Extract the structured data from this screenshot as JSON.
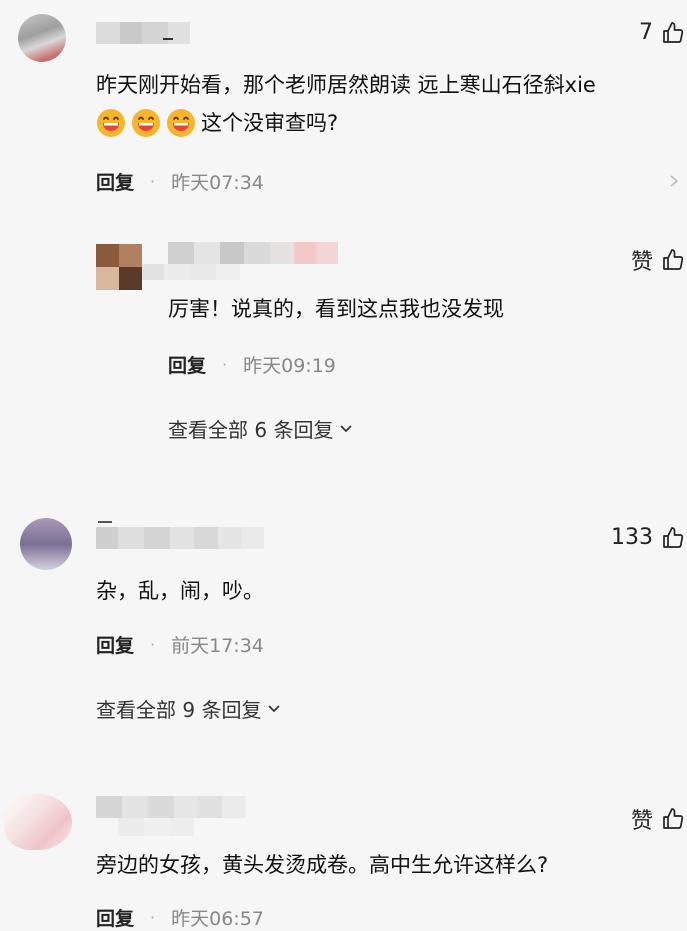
{
  "comments": [
    {
      "likes": "7",
      "text_line1": "昨天刚开始看，那个老师居然朗读 远上寒山石径斜xie",
      "text_line2": "这个没审查吗?",
      "reply_label": "回复",
      "time": "昨天07:34",
      "emoji_name": "grinning-face-emoji"
    },
    {
      "likes": "赞",
      "text": "厉害！说真的，看到这点我也没发现",
      "reply_label": "回复",
      "time": "昨天09:19",
      "view_more": "查看全部 6 条回复"
    },
    {
      "likes": "133",
      "text": "杂，乱，闹，吵。",
      "reply_label": "回复",
      "time": "前天17:34",
      "view_more": "查看全部 9 条回复"
    },
    {
      "likes": "赞",
      "text": "旁边的女孩，黄头发烫成卷。高中生允许这样么?",
      "reply_label": "回复",
      "time": "昨天06:57"
    }
  ],
  "colors": {
    "background": "#f6f6f6",
    "emoji_face": "#f7b52b",
    "emoji_mouth": "#e8433a"
  },
  "icons": {
    "like": "thumbs-up-outline-icon",
    "chevron": "chevron-down-icon"
  }
}
